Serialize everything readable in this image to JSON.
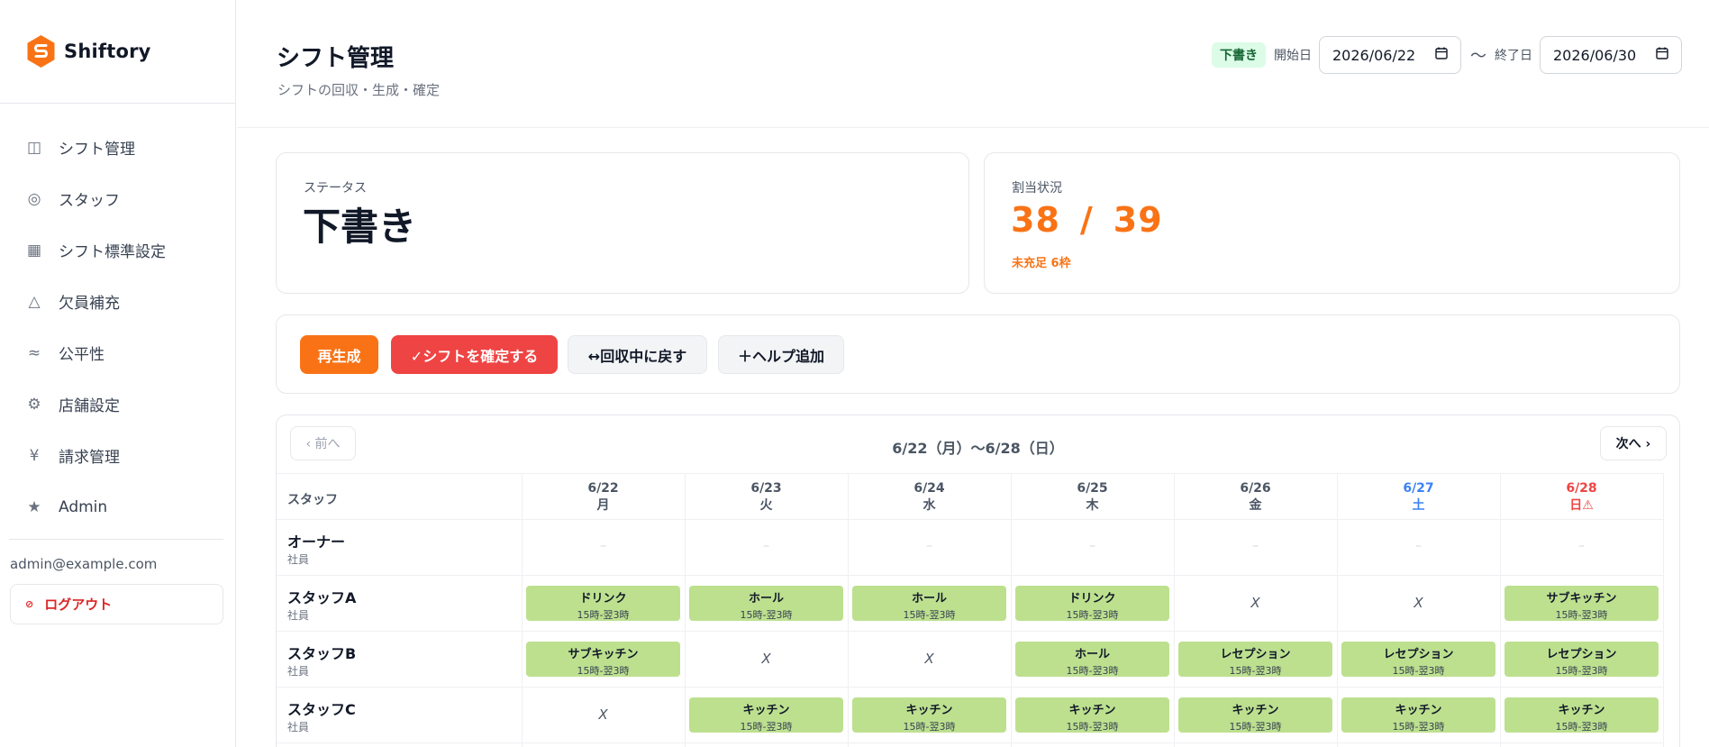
{
  "app": {
    "name": "Shiftory",
    "brand_color": "#f97316"
  },
  "sidebar": {
    "items": [
      {
        "label": "シフト管理",
        "icon": "columns-icon",
        "glyph": "◫"
      },
      {
        "label": "スタッフ",
        "icon": "circle-ring-icon",
        "glyph": "◎"
      },
      {
        "label": "シフト標準設定",
        "icon": "grid-icon",
        "glyph": "▦"
      },
      {
        "label": "欠員補充",
        "icon": "triangle-alert-icon",
        "glyph": "△"
      },
      {
        "label": "公平性",
        "icon": "approx-icon",
        "glyph": "≈"
      },
      {
        "label": "店舗設定",
        "icon": "gear-icon",
        "glyph": "⚙"
      },
      {
        "label": "請求管理",
        "icon": "yen-icon",
        "glyph": "¥"
      },
      {
        "label": "Admin",
        "icon": "star-icon",
        "glyph": "★"
      }
    ],
    "user_email": "admin@example.com",
    "logout_label": "ログアウト"
  },
  "header": {
    "title": "シフト管理",
    "subtitle": "シフトの回収・生成・確定",
    "badge": "下書き",
    "start_label": "開始日",
    "start_date": "2026/06/22",
    "tilde": "〜",
    "end_label": "終了日",
    "end_date": "2026/06/30"
  },
  "status_card": {
    "label": "ステータス",
    "value": "下書き"
  },
  "alloc_card": {
    "label": "割当状況",
    "assigned": "38",
    "separator": "/",
    "total": "39",
    "shortage": "未充足 6枠"
  },
  "actions": {
    "regenerate": "再生成",
    "confirm": "✓シフトを確定する",
    "revert": "↔回収中に戻す",
    "add_help": "＋ヘルプ追加"
  },
  "schedule": {
    "prev": "‹ 前へ",
    "next": "次へ ›",
    "range": "6/22（月）〜6/28（日）",
    "staff_header": "スタッフ",
    "days": [
      {
        "date": "6/22",
        "weekday": "月",
        "kind": "weekday"
      },
      {
        "date": "6/23",
        "weekday": "火",
        "kind": "weekday"
      },
      {
        "date": "6/24",
        "weekday": "水",
        "kind": "weekday"
      },
      {
        "date": "6/25",
        "weekday": "木",
        "kind": "weekday"
      },
      {
        "date": "6/26",
        "weekday": "金",
        "kind": "weekday"
      },
      {
        "date": "6/27",
        "weekday": "土",
        "kind": "sat"
      },
      {
        "date": "6/28",
        "weekday": "日⚠",
        "kind": "sun"
      }
    ],
    "rows": [
      {
        "name": "オーナー",
        "type": "社員",
        "cells": [
          {
            "kind": "empty",
            "text": "–"
          },
          {
            "kind": "empty",
            "text": "–"
          },
          {
            "kind": "empty",
            "text": "–"
          },
          {
            "kind": "empty",
            "text": "–"
          },
          {
            "kind": "empty",
            "text": "–"
          },
          {
            "kind": "empty",
            "text": "–"
          },
          {
            "kind": "empty",
            "text": "–"
          }
        ]
      },
      {
        "name": "スタッフA",
        "type": "社員",
        "cells": [
          {
            "kind": "shift",
            "role": "ドリンク",
            "time": "15時-翌3時"
          },
          {
            "kind": "shift",
            "role": "ホール",
            "time": "15時-翌3時"
          },
          {
            "kind": "shift",
            "role": "ホール",
            "time": "15時-翌3時"
          },
          {
            "kind": "shift",
            "role": "ドリンク",
            "time": "15時-翌3時"
          },
          {
            "kind": "off",
            "text": "X"
          },
          {
            "kind": "off",
            "text": "X"
          },
          {
            "kind": "shift",
            "role": "サブキッチン",
            "time": "15時-翌3時"
          }
        ]
      },
      {
        "name": "スタッフB",
        "type": "社員",
        "cells": [
          {
            "kind": "shift",
            "role": "サブキッチン",
            "time": "15時-翌3時"
          },
          {
            "kind": "off",
            "text": "X"
          },
          {
            "kind": "off",
            "text": "X"
          },
          {
            "kind": "shift",
            "role": "ホール",
            "time": "15時-翌3時"
          },
          {
            "kind": "shift",
            "role": "レセプション",
            "time": "15時-翌3時"
          },
          {
            "kind": "shift",
            "role": "レセプション",
            "time": "15時-翌3時"
          },
          {
            "kind": "shift",
            "role": "レセプション",
            "time": "15時-翌3時"
          }
        ]
      },
      {
        "name": "スタッフC",
        "type": "社員",
        "cells": [
          {
            "kind": "off",
            "text": "X"
          },
          {
            "kind": "shift",
            "role": "キッチン",
            "time": "15時-翌3時"
          },
          {
            "kind": "shift",
            "role": "キッチン",
            "time": "15時-翌3時"
          },
          {
            "kind": "shift",
            "role": "キッチン",
            "time": "15時-翌3時"
          },
          {
            "kind": "shift",
            "role": "キッチン",
            "time": "15時-翌3時"
          },
          {
            "kind": "shift",
            "role": "キッチン",
            "time": "15時-翌3時"
          },
          {
            "kind": "shift",
            "role": "キッチン",
            "time": "15時-翌3時"
          }
        ]
      }
    ]
  },
  "colors": {
    "shift_fill": "#bde08f",
    "danger": "#ef4444",
    "saturday": "#3b82f6",
    "sunday": "#ef4444"
  }
}
